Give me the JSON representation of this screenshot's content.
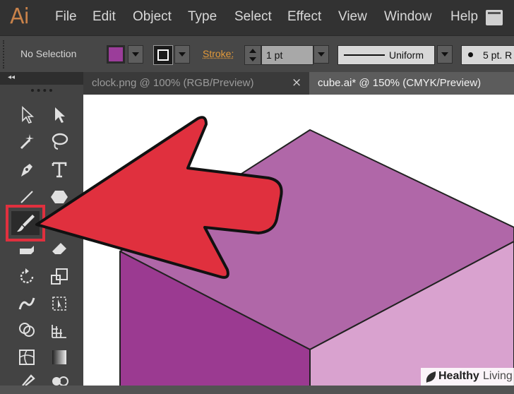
{
  "app": {
    "logo": "Ai"
  },
  "menu": {
    "items": [
      "File",
      "Edit",
      "Object",
      "Type",
      "Select",
      "Effect",
      "View",
      "Window",
      "Help"
    ]
  },
  "control_bar": {
    "selection_status": "No Selection",
    "fill_color": "#9b3d9a",
    "stroke_label": "Stroke:",
    "stroke_weight": "1 pt",
    "stroke_profile": "Uniform",
    "brush_label": "5 pt. R"
  },
  "tabs": [
    {
      "label": "clock.png @ 100% (RGB/Preview)",
      "close": "×",
      "active": false
    },
    {
      "label": "cube.ai* @ 150% (CMYK/Preview)",
      "active": true
    }
  ],
  "toolbox": {
    "collapse_glyph": "◂◂",
    "highlighted_tool": "paintbrush-tool"
  },
  "artwork": {
    "cube_top_color": "#b067a8",
    "cube_left_color": "#9b3a91",
    "cube_right_color": "#d9a2cf",
    "arrow_color": "#e0303e"
  },
  "watermark": {
    "brand_bold": "Healthy",
    "brand_light": "Living"
  }
}
